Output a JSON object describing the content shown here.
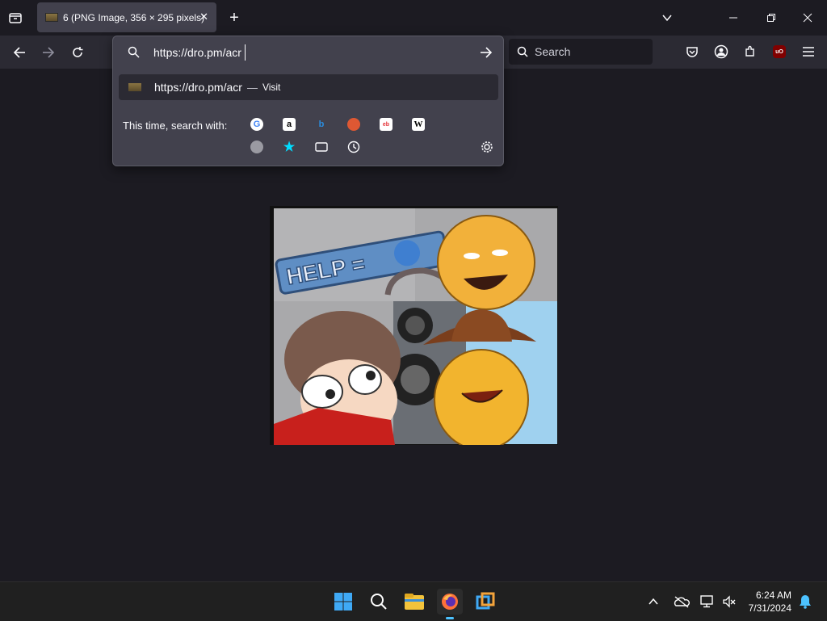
{
  "tab": {
    "title": "6 (PNG Image, 356 × 295 pixels)"
  },
  "urlbar": {
    "value": "https://dro.pm/acr"
  },
  "search": {
    "placeholder": "Search"
  },
  "suggestion": {
    "url": "https://dro.pm/acr",
    "sep": "—",
    "action": "Visit"
  },
  "engines": {
    "label": "This time, search with:"
  },
  "image": {
    "help_text": "HELP ="
  },
  "clock": {
    "time": "6:24 AM",
    "date": "7/31/2024"
  },
  "colors": {
    "accent": "#00ddff",
    "bg": "#1c1b22",
    "toolbar": "#2b2a33"
  }
}
